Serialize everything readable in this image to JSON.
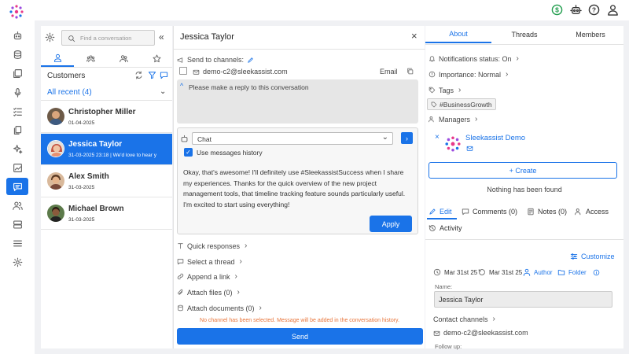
{
  "colors": {
    "accent": "#1a73e8",
    "warning": "#e8753a",
    "success": "#1f9d4c"
  },
  "customers_panel": {
    "search_placeholder": "Find a conversation",
    "heading": "Customers",
    "filter_label": "All recent (4)",
    "items": [
      {
        "name": "Christopher Miller",
        "date": "01-04-2025",
        "preview": ""
      },
      {
        "name": "Jessica Taylor",
        "date": "31-03-2025 23:18",
        "preview": "We'd love to hear y"
      },
      {
        "name": "Alex Smith",
        "date": "31-03-2025",
        "preview": ""
      },
      {
        "name": "Michael Brown",
        "date": "31-03-2025",
        "preview": ""
      }
    ]
  },
  "conversation": {
    "title": "Jessica Taylor",
    "send_to_label": "Send to channels:",
    "channel_email": "demo-c2@sleekassist.com",
    "channel_type": "Email",
    "reply_prompt": "Please make a reply to this conversation",
    "chat_select": "Chat",
    "use_history_label": "Use messages history",
    "message": "Okay, that's awesome! I'll definitely use #SleekassistSuccess when I share my experiences. Thanks for the quick overview of the new project management tools, that timeline tracking feature sounds particularly useful. I'm excited to start using everything!",
    "apply_label": "Apply",
    "options": [
      "Quick responses",
      "Select a thread",
      "Append a link",
      "Attach files (0)",
      "Attach documents (0)"
    ],
    "warning": "No channel has been selected. Message will be added in the conversation history.",
    "send_label": "Send"
  },
  "right_panel": {
    "tabs": [
      "About",
      "Threads",
      "Members"
    ],
    "notifications": "Notifications status: On",
    "importance": "Importance: Normal",
    "tags_label": "Tags",
    "tag": "#BusinessGrowth",
    "managers_label": "Managers",
    "manager_name": "Sleekassist Demo",
    "create_label": "+ Create",
    "empty_text": "Nothing has been found",
    "sub_tabs": [
      "Edit",
      "Comments (0)",
      "Notes (0)",
      "Access",
      "Activity"
    ],
    "customize_label": "Customize",
    "meta": {
      "created": "Mar 31st 25",
      "updated": "Mar 31st 25",
      "author": "Author",
      "folder": "Folder"
    },
    "name_label": "Name:",
    "name_value": "Jessica Taylor",
    "contact_channels_label": "Contact channels",
    "contact_email": "demo-c2@sleekassist.com",
    "follow_up_label": "Follow up:"
  }
}
